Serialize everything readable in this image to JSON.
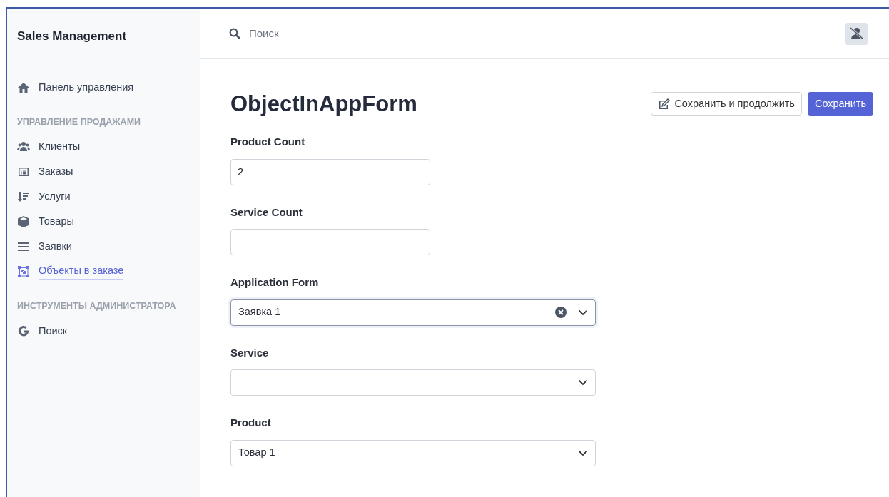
{
  "sidebar": {
    "brand": "Sales Management",
    "items": [
      {
        "kind": "link",
        "label": "Панель управления",
        "selected": false
      },
      {
        "kind": "section",
        "label": "УПРАВЛЕНИЕ ПРОДАЖАМИ"
      },
      {
        "kind": "link",
        "label": "Клиенты",
        "selected": false
      },
      {
        "kind": "link",
        "label": "Заказы",
        "selected": false
      },
      {
        "kind": "link",
        "label": "Услуги",
        "selected": false
      },
      {
        "kind": "link",
        "label": "Товары",
        "selected": false
      },
      {
        "kind": "link",
        "label": "Заявки",
        "selected": false
      },
      {
        "kind": "link",
        "label": "Объекты в заказе",
        "selected": true
      },
      {
        "kind": "section",
        "label": "ИНСТРУМЕНТЫ АДМИНИСТРАТОРА"
      },
      {
        "kind": "link",
        "label": "Поиск",
        "selected": false
      }
    ]
  },
  "topbar": {
    "search": {
      "placeholder": "Поиск"
    }
  },
  "page": {
    "title": "ObjectInAppForm",
    "buttons": [
      {
        "kind": "secondary",
        "label": "Сохранить и продолжить"
      },
      {
        "kind": "primary",
        "label": "Сохранить"
      }
    ]
  },
  "fields": [
    {
      "kind": "text",
      "label": "Product Count",
      "value": "2"
    },
    {
      "kind": "text",
      "label": "Service Count"
    },
    {
      "kind": "select",
      "label": "Application Form",
      "value": "Заявка 1",
      "clearable": true,
      "focused": true
    },
    {
      "kind": "select",
      "label": "Service",
      "clearable": false,
      "focused": false
    },
    {
      "kind": "select",
      "label": "Product",
      "value": "Товар 1",
      "clearable": false,
      "focused": false
    }
  ]
}
